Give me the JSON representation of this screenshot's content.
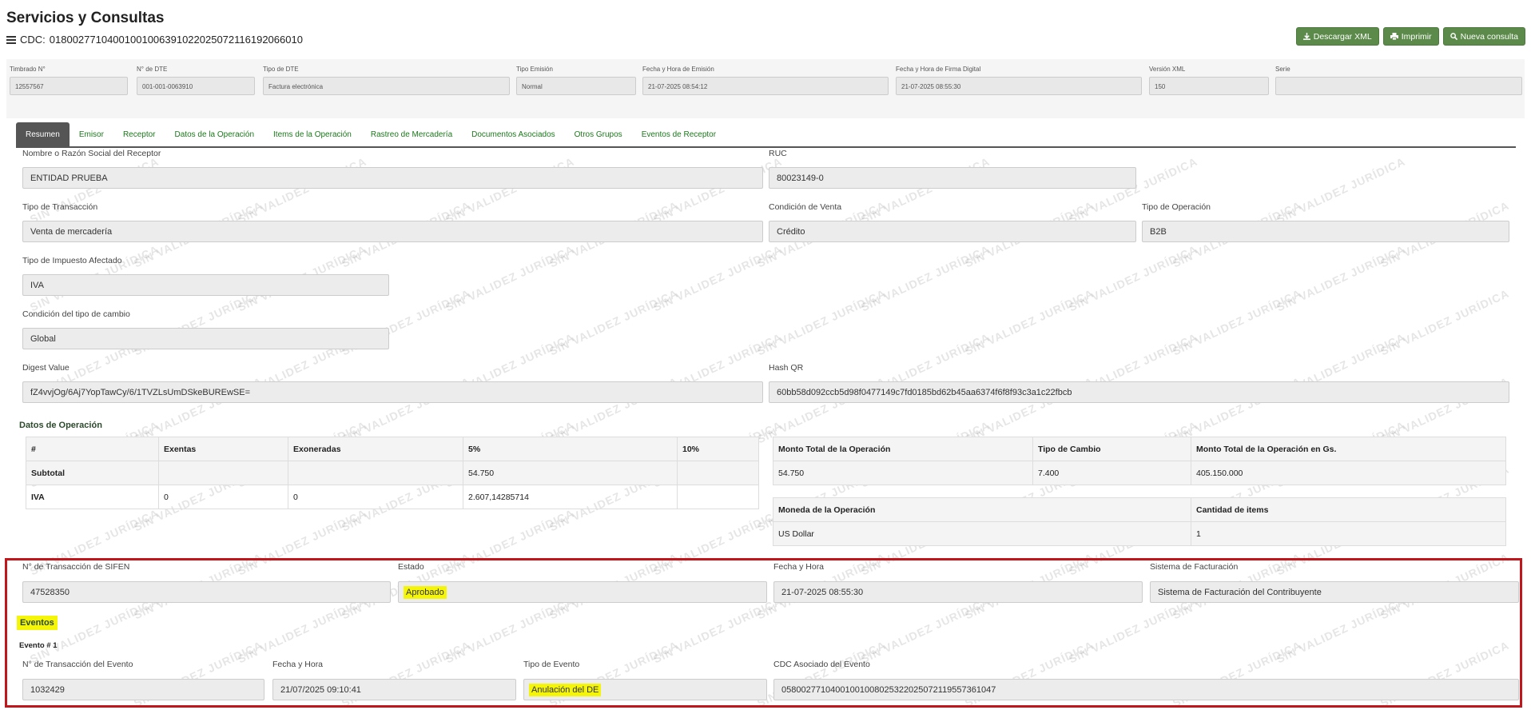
{
  "header": {
    "title": "Servicios y Consultas",
    "cdc_label": "CDC:",
    "cdc_value": "01800277104001001006391022025072116192066010"
  },
  "actions": {
    "download_xml": "Descargar XML",
    "print": "Imprimir",
    "new_query": "Nueva consulta"
  },
  "summary": {
    "fields": [
      {
        "label": "Timbrado N°",
        "value": "12557567"
      },
      {
        "label": "N° de DTE",
        "value": "001-001-0063910"
      },
      {
        "label": "Tipo de DTE",
        "value": "Factura electrónica"
      },
      {
        "label": "Tipo Emisión",
        "value": "Normal"
      },
      {
        "label": "Fecha y Hora de Emisión",
        "value": "21-07-2025 08:54:12"
      },
      {
        "label": "Fecha y Hora de Firma Digital",
        "value": "21-07-2025 08:55:30"
      },
      {
        "label": "Versión XML",
        "value": "150"
      },
      {
        "label": "Serie",
        "value": ""
      }
    ]
  },
  "tabs": [
    {
      "label": "Resumen",
      "active": true
    },
    {
      "label": "Emisor"
    },
    {
      "label": "Receptor"
    },
    {
      "label": "Datos de la Operación"
    },
    {
      "label": "Items de la Operación"
    },
    {
      "label": "Rastreo de Mercadería"
    },
    {
      "label": "Documentos Asociados"
    },
    {
      "label": "Otros Grupos"
    },
    {
      "label": "Eventos de Receptor"
    }
  ],
  "resumen": {
    "receptor_name": {
      "label": "Nombre o Razón Social del Receptor",
      "value": "ENTIDAD PRUEBA"
    },
    "ruc": {
      "label": "RUC",
      "value": "80023149-0"
    },
    "tipo_transaccion": {
      "label": "Tipo de Transacción",
      "value": "Venta de mercadería"
    },
    "condicion_venta": {
      "label": "Condición de Venta",
      "value": "Crédito"
    },
    "tipo_operacion": {
      "label": "Tipo de Operación",
      "value": "B2B"
    },
    "tipo_impuesto": {
      "label": "Tipo de Impuesto Afectado",
      "value": "IVA"
    },
    "condicion_cambio": {
      "label": "Condición del tipo de cambio",
      "value": "Global"
    },
    "digest": {
      "label": "Digest Value",
      "value": "fZ4vvjOg/6Aj7YopTawCy/6/1TVZLsUmDSkeBUREwSE="
    },
    "hash_qr": {
      "label": "Hash QR",
      "value": "60bb58d092ccb5d98f0477149c7fd0185bd62b45aa6374f6f8f93c3a1c22fbcb"
    }
  },
  "datos_operacion": {
    "title": "Datos de Operación",
    "tax_table": {
      "headers": [
        "#",
        "Exentas",
        "Exoneradas",
        "5%",
        "10%"
      ],
      "rows": [
        [
          "Subtotal",
          "",
          "",
          "54.750",
          ""
        ],
        [
          "IVA",
          "0",
          "0",
          "2.607,14285714",
          ""
        ]
      ]
    },
    "totals_table": {
      "headers": [
        "Monto Total de la Operación",
        "Tipo de Cambio",
        "Monto Total de la Operación en Gs."
      ],
      "row": [
        "54.750",
        "7.400",
        "405.150.000"
      ]
    },
    "currency_table": {
      "headers": [
        "Moneda de la Operación",
        "Cantidad de items"
      ],
      "row": [
        "US Dollar",
        "1"
      ]
    }
  },
  "sifen": {
    "transaccion": {
      "label": "N° de Transacción de SIFEN",
      "value": "47528350"
    },
    "estado": {
      "label": "Estado",
      "value": "Aprobado"
    },
    "fecha": {
      "label": "Fecha y Hora",
      "value": "21-07-2025 08:55:30"
    },
    "sistema": {
      "label": "Sistema de Facturación",
      "value": "Sistema de Facturación del Contribuyente"
    }
  },
  "eventos": {
    "title": "Eventos",
    "evento_title": "Evento # 1",
    "transaccion": {
      "label": "N° de Transacción del Evento",
      "value": "1032429"
    },
    "fecha": {
      "label": "Fecha y Hora",
      "value": "21/07/2025 09:10:41"
    },
    "tipo": {
      "label": "Tipo de Evento",
      "value": "Anulación del DE"
    },
    "cdc": {
      "label": "CDC Asociado del Evento",
      "value": "05800277104001001008025322025072119557361047"
    }
  },
  "watermark_text": "SIN VALIDEZ JURÍDICA",
  "colors": {
    "button": "#5b8a4a",
    "tab_text": "#1a7a1a",
    "highlight": "#f5f50a",
    "red_frame": "#c0161c"
  }
}
